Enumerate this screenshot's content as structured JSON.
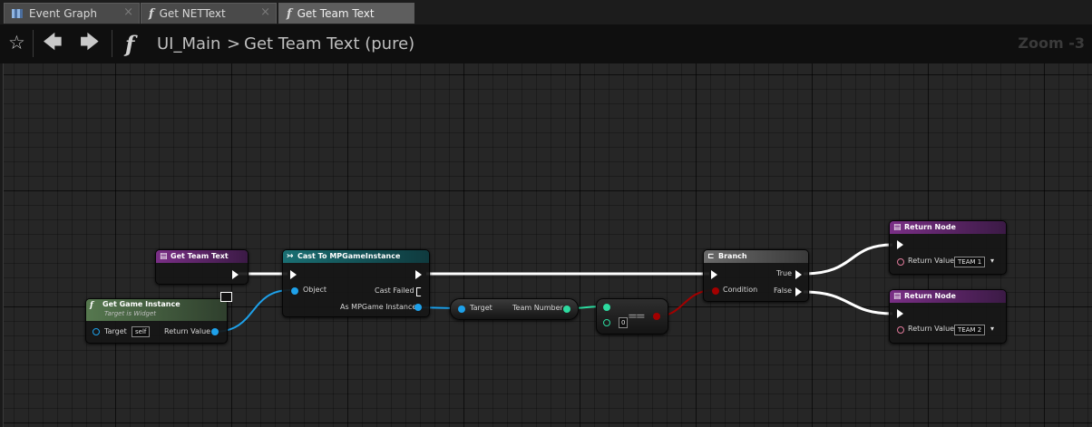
{
  "tabs": [
    {
      "label": "Event Graph"
    },
    {
      "label": "Get NETText"
    },
    {
      "label": "Get Team Text"
    }
  ],
  "breadcrumb": {
    "blueprint": "UI_Main",
    "separator": ">",
    "function": "Get Team Text (pure)"
  },
  "zoom_label": "Zoom -3",
  "nodes": {
    "entry": {
      "title": "Get Team Text"
    },
    "game_instance": {
      "title": "Get Game Instance",
      "subtitle": "Target is Widget",
      "target_label": "Target",
      "target_value": "self",
      "return_label": "Return Value"
    },
    "cast": {
      "title": "Cast To MPGameInstance",
      "object_label": "Object",
      "cast_failed_label": "Cast Failed",
      "as_label": "As MPGame Instance"
    },
    "team_number": {
      "target_label": "Target",
      "output_label": "Team Number"
    },
    "equal": {
      "symbol": "==",
      "value": "0"
    },
    "branch": {
      "title": "Branch",
      "condition_label": "Condition",
      "true_label": "True",
      "false_label": "False"
    },
    "return1": {
      "title": "Return Node",
      "label": "Return Value",
      "value": "TEAM 1"
    },
    "return2": {
      "title": "Return Node",
      "label": "Return Value",
      "value": "TEAM 2"
    }
  },
  "colors": {
    "function_header": "#7a2f86",
    "cast_header": "#1a6f73",
    "pure_header": "#4f6f4c",
    "branch_header": "#5a5a5a",
    "object_pin": "#1ea1ea",
    "integer_pin": "#2ddba0",
    "boolean_pin": "#a30000",
    "text_pin": "#e07a9a"
  }
}
